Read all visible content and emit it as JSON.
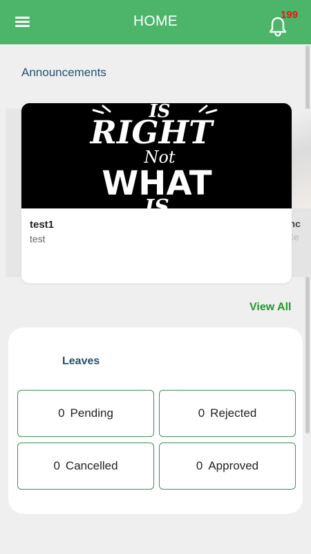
{
  "header": {
    "title": "HOME",
    "notification_count": "199",
    "color": "#4cb56a"
  },
  "announcements": {
    "section_label": "Announcements",
    "items": [
      {
        "title": "test1",
        "description": "test",
        "image_text": [
          "IS",
          "RIGHT",
          "Not",
          "WHAT",
          "IS"
        ]
      },
      {
        "title_fragment": "unc",
        "description_fragment": "nce"
      }
    ],
    "view_all_label": "View All"
  },
  "leaves": {
    "title": "Leaves",
    "stats": [
      {
        "count": "0",
        "label": "Pending"
      },
      {
        "count": "0",
        "label": "Rejected"
      },
      {
        "count": "0",
        "label": "Cancelled"
      },
      {
        "count": "0",
        "label": "Approved"
      }
    ]
  },
  "colors": {
    "accent_green": "#4cb56a",
    "link_green": "#1e9a2a",
    "heading_blue": "#25536d",
    "badge_red": "#e21a1a",
    "stat_border": "#3e8e5c"
  }
}
